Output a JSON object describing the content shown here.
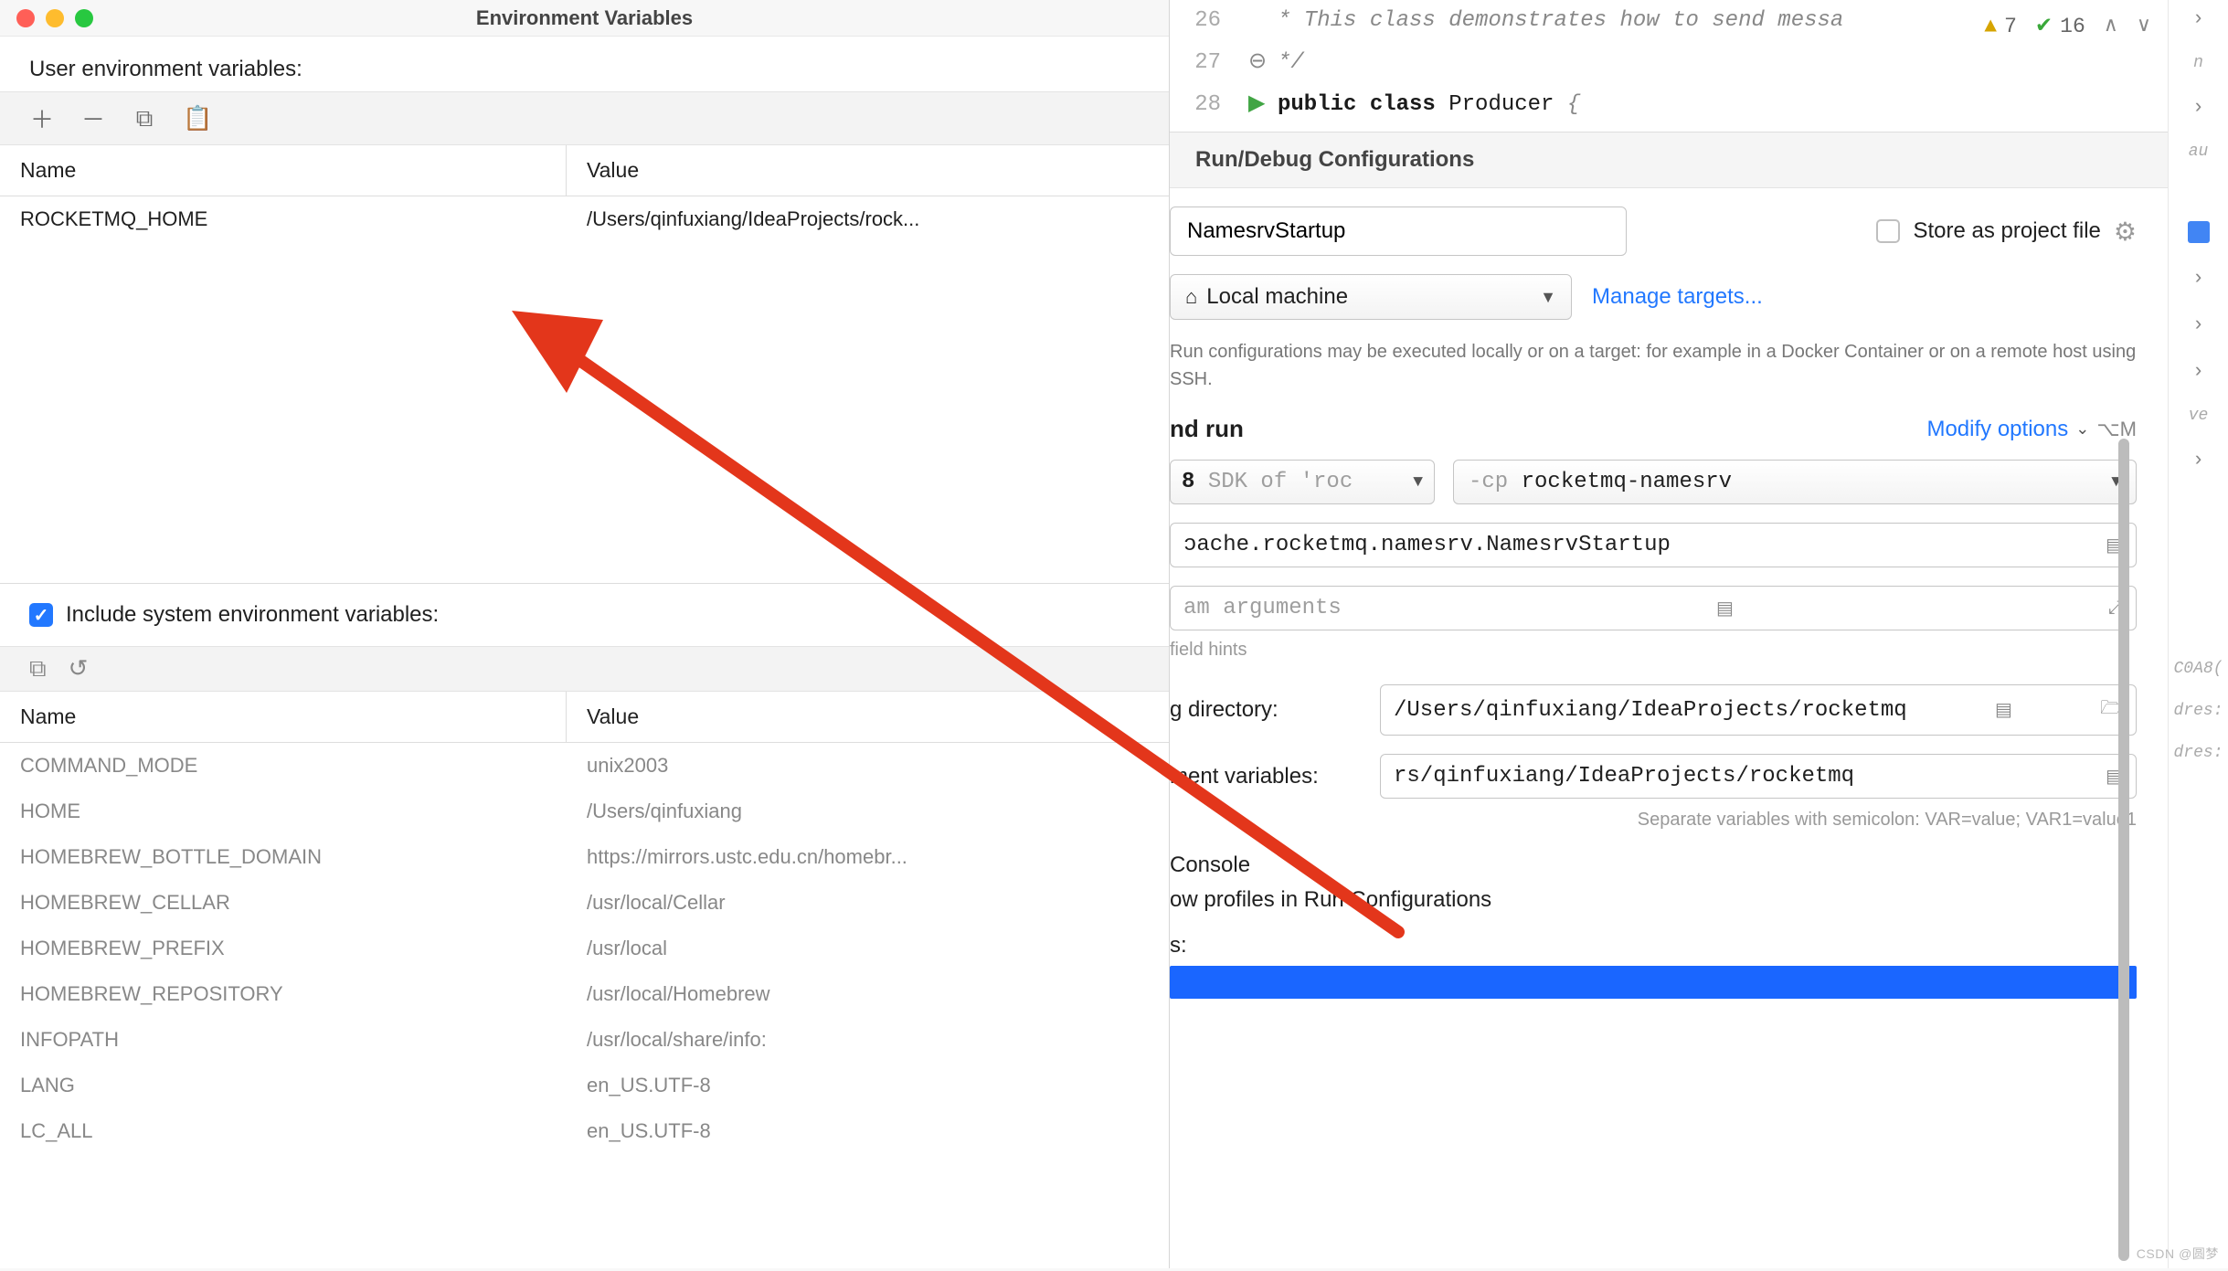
{
  "dialog": {
    "title": "Environment Variables",
    "user_section_label": "User environment variables:",
    "user_table": {
      "headers": {
        "name": "Name",
        "value": "Value"
      },
      "rows": [
        {
          "name": "ROCKETMQ_HOME",
          "value": "/Users/qinfuxiang/IdeaProjects/rock..."
        }
      ]
    },
    "include_system_label": "Include system environment variables:",
    "sys_table": {
      "headers": {
        "name": "Name",
        "value": "Value"
      },
      "rows": [
        {
          "name": "COMMAND_MODE",
          "value": "unix2003"
        },
        {
          "name": "HOME",
          "value": "/Users/qinfuxiang"
        },
        {
          "name": "HOMEBREW_BOTTLE_DOMAIN",
          "value": "https://mirrors.ustc.edu.cn/homebr..."
        },
        {
          "name": "HOMEBREW_CELLAR",
          "value": "/usr/local/Cellar"
        },
        {
          "name": "HOMEBREW_PREFIX",
          "value": "/usr/local"
        },
        {
          "name": "HOMEBREW_REPOSITORY",
          "value": "/usr/local/Homebrew"
        },
        {
          "name": "INFOPATH",
          "value": "/usr/local/share/info:"
        },
        {
          "name": "LANG",
          "value": "en_US.UTF-8"
        },
        {
          "name": "LC_ALL",
          "value": "en_US.UTF-8"
        }
      ]
    }
  },
  "code_peek": {
    "lines": [
      {
        "num": "26",
        "text": "* This class demonstrates how to send messa"
      },
      {
        "num": "27",
        "text": "*/"
      },
      {
        "num": "28",
        "text_html": "public class Producer {"
      }
    ],
    "badges": {
      "warn_count": "7",
      "ok_count": "16"
    }
  },
  "run": {
    "title": "Run/Debug Configurations",
    "name_field": "NamesrvStartup",
    "store_label": "Store as project file",
    "target_label": "Local machine",
    "manage_targets": "Manage targets...",
    "helper": "Run configurations may be executed locally or on a target: for example in a Docker Container or on a remote host using SSH.",
    "section_nd_run": "nd run",
    "modify_options": "Modify options",
    "modify_kbd": "⌥M",
    "jdk_field_prefix": "8",
    "jdk_field": "SDK of 'roc",
    "cp_prefix": "-cp",
    "cp_module": "rocketmq-namesrv",
    "main_class": "ɔache.rocketmq.namesrv.NamesrvStartup",
    "program_args_placeholder": "am arguments",
    "field_hints": " field hints",
    "wd_label": "g directory:",
    "wd_value": "/Users/qinfuxiang/IdeaProjects/rocketmq",
    "env_label": "ment variables:",
    "env_value": "rs/qinfuxiang/IdeaProjects/rocketmq",
    "sep_note": "Separate variables with semicolon: VAR=value; VAR1=value1",
    "console_label": "Console",
    "profiles_label": "ow profiles in Run Configurations",
    "s_colon": "s:"
  },
  "far_gutter": {
    "items": [
      "n",
      "au",
      "ve",
      "C0A8(",
      "dres:",
      "dres:"
    ]
  },
  "watermark": "CSDN @圆梦"
}
